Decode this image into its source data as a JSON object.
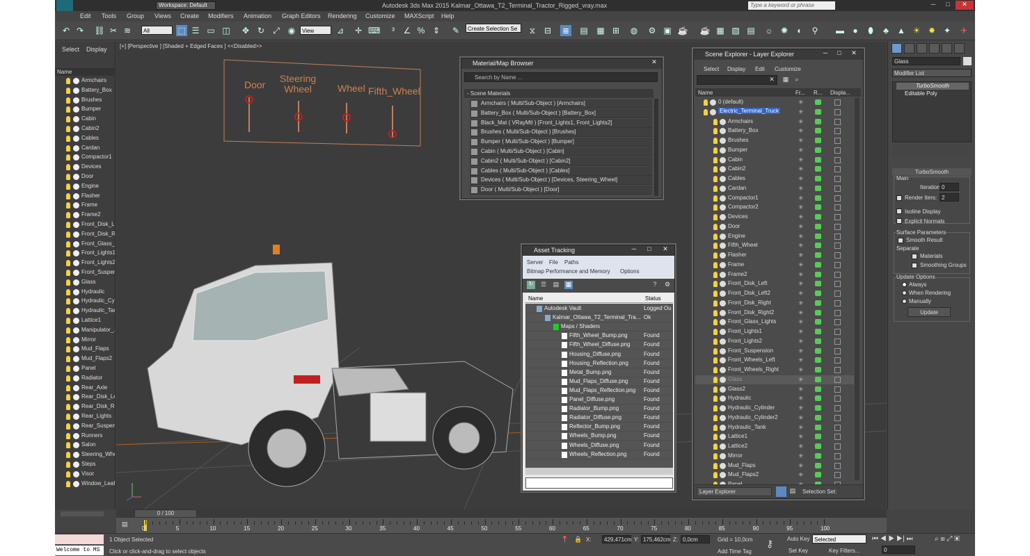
{
  "app_title": "Autodesk 3ds Max 2015    Kalmar_Ottawa_T2_Terminal_Tractor_Rigged_vray.max",
  "workspace": "Workspace: Default",
  "search_placeholder": "Type a keyword or phrase",
  "menu": [
    "Edit",
    "Tools",
    "Group",
    "Views",
    "Create",
    "Modifiers",
    "Animation",
    "Graph Editors",
    "Rendering",
    "Customize",
    "MAXScript",
    "Help"
  ],
  "toolbar": {
    "filter_all": "All",
    "view": "View",
    "selection_set": "Create Selection Se"
  },
  "left_panel": {
    "tabs": [
      "Select",
      "Display"
    ],
    "header": "Name",
    "items": [
      "Armchairs",
      "Battery_Box",
      "Brushes",
      "Bumper",
      "Cabin",
      "Cabin2",
      "Cables",
      "Cardan",
      "Compactor1",
      "Devices",
      "Door",
      "Engine",
      "Flasher",
      "Frame",
      "Frame2",
      "Front_Disk_L...",
      "Front_Disk_Ri...",
      "Front_Glass_...",
      "Front_Lights1",
      "Front_Lights2",
      "Front_Suspen...",
      "Glass",
      "Hydraulic",
      "Hydraulic_Cyli...",
      "Hydraulic_Tan...",
      "Lattice1",
      "Manipulator_...",
      "Mirror",
      "Mud_Flaps",
      "Mud_Flaps2",
      "Panel",
      "Radiator",
      "Rear_Axle",
      "Rear_Disk_Le...",
      "Rear_Disk_Ri...",
      "Rear_Lights",
      "Rear_Suspen...",
      "Runners",
      "Salon",
      "Steering_Whe...",
      "Steps",
      "Visor",
      "Window_Leaf"
    ]
  },
  "viewport": {
    "label": "[+] [Perspective ] [Shaded + Edged Faces ]  <<Disabled>>",
    "rig_labels": [
      "Door",
      "Steering\nWheel",
      "Wheel",
      "Fifth_Wheel"
    ]
  },
  "material_browser": {
    "title": "Material/Map Browser",
    "search": "Search by Name ...",
    "group": "- Scene Materials",
    "items": [
      "Armchairs  ( Multi/Sub-Object ) [Armchairs]",
      "Battery_Box  ( Multi/Sub-Object ) [Battery_Box]",
      "Black_Mat  ( VRayMtl ) [Front_Lights1, Front_Lights2]",
      "Brushes  ( Multi/Sub-Object ) [Brushes]",
      "Bumper  ( Multi/Sub-Object ) [Bumper]",
      "Cabin  ( Multi/Sub-Object ) [Cabin]",
      "Cabin2  ( Multi/Sub-Object ) [Cabin2]",
      "Cables  ( Multi/Sub-Object ) [Cables]",
      "Devices  ( Multi/Sub-Object ) [Devices, Steering_Wheel]",
      "Door  ( Multi/Sub-Object ) [Door]"
    ]
  },
  "asset_tracking": {
    "title": "Asset Tracking",
    "menu1": [
      "Server",
      "File",
      "Paths"
    ],
    "menu2": [
      "Bitmap Performance and Memory",
      "Options"
    ],
    "col_name": "Name",
    "col_status": "Status",
    "rows": [
      {
        "name": "Autodesk Vault",
        "status": "Logged Ou",
        "indent": 1
      },
      {
        "name": "Kalmar_Ottawa_T2_Terminal_Tra...",
        "status": "Ok",
        "indent": 2
      },
      {
        "name": "Maps / Shaders",
        "status": "",
        "indent": 3
      },
      {
        "name": "Fifth_Wheel_Bump.png",
        "status": "Found",
        "indent": 4
      },
      {
        "name": "Fifth_Wheel_Diffuse.png",
        "status": "Found",
        "indent": 4
      },
      {
        "name": "Housing_Diffuse.png",
        "status": "Found",
        "indent": 4
      },
      {
        "name": "Housing_Reflection.png",
        "status": "Found",
        "indent": 4
      },
      {
        "name": "Metal_Bump.png",
        "status": "Found",
        "indent": 4
      },
      {
        "name": "Mud_Flaps_Diffuse.png",
        "status": "Found",
        "indent": 4
      },
      {
        "name": "Mud_Flaps_Reflection.png",
        "status": "Found",
        "indent": 4
      },
      {
        "name": "Panel_Diffuse.png",
        "status": "Found",
        "indent": 4
      },
      {
        "name": "Radiator_Bump.png",
        "status": "Found",
        "indent": 4
      },
      {
        "name": "Radiator_Diffuse.png",
        "status": "Found",
        "indent": 4
      },
      {
        "name": "Reflector_Bump.png",
        "status": "Found",
        "indent": 4
      },
      {
        "name": "Wheels_Bump.png",
        "status": "Found",
        "indent": 4
      },
      {
        "name": "Wheels_Diffuse.png",
        "status": "Found",
        "indent": 4
      },
      {
        "name": "Wheels_Reflection.png",
        "status": "Found",
        "indent": 4
      }
    ]
  },
  "scene_explorer": {
    "title": "Scene Explorer - Layer Explorer",
    "menu": [
      "Select",
      "Display",
      "Edit",
      "Customize"
    ],
    "cols": [
      "Name",
      "Fr...",
      "R...",
      "Displa..."
    ],
    "layer0": "0 (default)",
    "layer1": "Electric_Terminal_Truck",
    "items": [
      "Armchairs",
      "Battery_Box",
      "Brushes",
      "Bumper",
      "Cabin",
      "Cabin2",
      "Cables",
      "Cardan",
      "Compactor1",
      "Compactor2",
      "Devices",
      "Door",
      "Engine",
      "Fifth_Wheel",
      "Flasher",
      "Frame",
      "Frame2",
      "Front_Disk_Left",
      "Front_Disk_Left2",
      "Front_Disk_Right",
      "Front_Disk_Right2",
      "Front_Glass_Lights",
      "Front_Lights1",
      "Front_Lights2",
      "Front_Suspension",
      "Front_Wheels_Left",
      "Front_Wheels_Right",
      "Glass",
      "Glass2",
      "Hydraulic",
      "Hydraulic_Cylinder",
      "Hydraulic_Cylinder2",
      "Hydraulic_Tank",
      "Lattice1",
      "Lattice2",
      "Mirror",
      "Mud_Flaps",
      "Mud_Flaps2",
      "Panel"
    ],
    "footer_layer": "Layer Explorer",
    "footer_sel": "Selection Set:"
  },
  "command_panel": {
    "object_name": "Glass",
    "modifier_list": "Modifier List",
    "stack": [
      "TurboSmooth",
      "Editable Poly"
    ],
    "rollout": "TurboSmooth",
    "main": "Main",
    "iterations_label": "Iterations:",
    "iterations": "0",
    "render_iters_label": "Render Iters:",
    "render_iters": "2",
    "isoline": "Isoline Display",
    "explicit": "Explicit Normals",
    "surface": "Surface Parameters",
    "smooth": "Smooth Result",
    "separate": "Separate",
    "materials": "Materials",
    "smoothing": "Smoothing Groups",
    "update_opts": "Update Options",
    "always": "Always",
    "when_rendering": "When Rendering",
    "manually": "Manually",
    "update_btn": "Update"
  },
  "timeline": {
    "frame": "0 / 100",
    "ticks": [
      "0",
      "5",
      "10",
      "15",
      "20",
      "25",
      "30",
      "35",
      "40",
      "45",
      "50",
      "55",
      "60",
      "65",
      "70",
      "75",
      "80",
      "85",
      "90",
      "95",
      "100"
    ]
  },
  "status": {
    "welcome": "Welcome to MS",
    "selected": "1 Object Selected",
    "prompt": "Click or click-and-drag to select objects",
    "x": "429,471cm",
    "y": "175,462cm",
    "z": "0,0cm",
    "grid": "Grid = 10,0cm",
    "add_time_tag": "Add Time Tag",
    "auto_key": "Auto Key",
    "set_key": "Set Key",
    "key_mode": "Selected",
    "key_filters": "Key Filters...",
    "frame_field": "0"
  }
}
